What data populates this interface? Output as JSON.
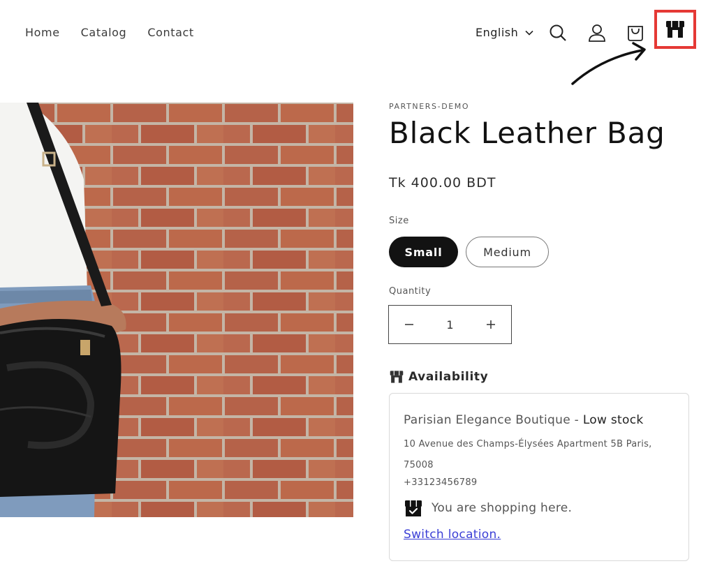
{
  "header": {
    "nav": [
      {
        "label": "Home"
      },
      {
        "label": "Catalog"
      },
      {
        "label": "Contact"
      }
    ],
    "language": "English",
    "icons": [
      "search-icon",
      "account-icon",
      "cart-icon",
      "store-icon"
    ],
    "highlight_color": "#e53935"
  },
  "product": {
    "vendor": "PARTNERS-DEMO",
    "title": "Black Leather Bag",
    "price": "Tk 400.00 BDT",
    "size_label": "Size",
    "sizes": [
      {
        "label": "Small",
        "selected": true
      },
      {
        "label": "Medium",
        "selected": false
      }
    ],
    "quantity_label": "Quantity",
    "quantity_value": "1"
  },
  "availability": {
    "heading": "Availability",
    "location_name": "Parisian Elegance Boutique - ",
    "stock_status": "Low stock",
    "address": "10 Avenue des Champs-Élysées Apartment 5B Paris, 75008",
    "phone": "+33123456789",
    "shopping_here": "You are shopping here.",
    "switch_link": "Switch location."
  },
  "colors": {
    "primary": "#121212",
    "link": "#3b3fd6"
  }
}
